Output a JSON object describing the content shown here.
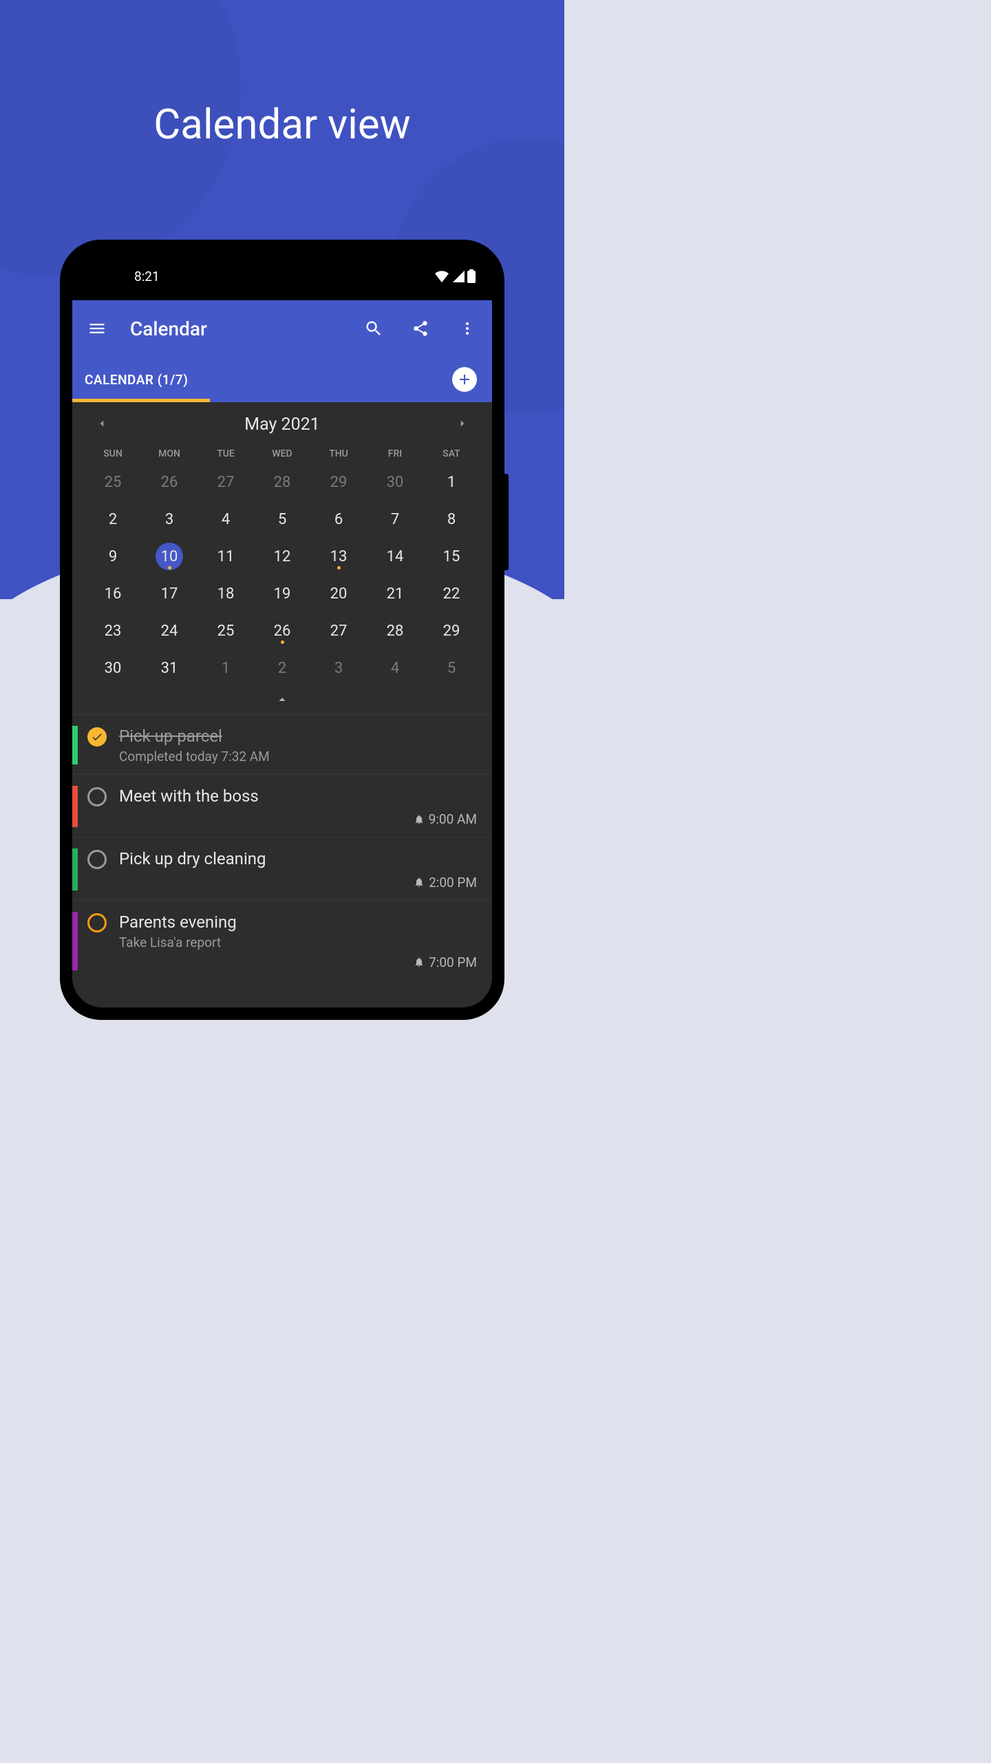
{
  "heading": "Calendar view",
  "status": {
    "time": "8:21"
  },
  "appbar": {
    "title": "Calendar"
  },
  "tab": {
    "label": "CALENDAR (1/7)"
  },
  "month": {
    "label": "May 2021"
  },
  "dow": [
    "SUN",
    "MON",
    "TUE",
    "WED",
    "THU",
    "FRI",
    "SAT"
  ],
  "weeks": [
    [
      {
        "n": "25",
        "dim": true
      },
      {
        "n": "26",
        "dim": true
      },
      {
        "n": "27",
        "dim": true
      },
      {
        "n": "28",
        "dim": true
      },
      {
        "n": "29",
        "dim": true
      },
      {
        "n": "30",
        "dim": true
      },
      {
        "n": "1"
      }
    ],
    [
      {
        "n": "2"
      },
      {
        "n": "3"
      },
      {
        "n": "4"
      },
      {
        "n": "5"
      },
      {
        "n": "6"
      },
      {
        "n": "7"
      },
      {
        "n": "8"
      }
    ],
    [
      {
        "n": "9"
      },
      {
        "n": "10",
        "selected": true,
        "dot": true
      },
      {
        "n": "11"
      },
      {
        "n": "12"
      },
      {
        "n": "13",
        "dot": true
      },
      {
        "n": "14"
      },
      {
        "n": "15"
      }
    ],
    [
      {
        "n": "16"
      },
      {
        "n": "17"
      },
      {
        "n": "18"
      },
      {
        "n": "19"
      },
      {
        "n": "20"
      },
      {
        "n": "21"
      },
      {
        "n": "22"
      }
    ],
    [
      {
        "n": "23"
      },
      {
        "n": "24"
      },
      {
        "n": "25"
      },
      {
        "n": "26",
        "dot": true
      },
      {
        "n": "27"
      },
      {
        "n": "28"
      },
      {
        "n": "29"
      }
    ],
    [
      {
        "n": "30"
      },
      {
        "n": "31"
      },
      {
        "n": "1",
        "dim": true
      },
      {
        "n": "2",
        "dim": true
      },
      {
        "n": "3",
        "dim": true
      },
      {
        "n": "4",
        "dim": true
      },
      {
        "n": "5",
        "dim": true
      }
    ]
  ],
  "tasks": [
    {
      "title": "Pick up parcel",
      "sub": "Completed today 7:32 AM",
      "done": true,
      "color": "#2ecc71",
      "time": ""
    },
    {
      "title": "Meet with the boss",
      "sub": "",
      "done": false,
      "color": "#e74c3c",
      "time": "9:00 AM",
      "ring": "gray"
    },
    {
      "title": "Pick up dry cleaning",
      "sub": "",
      "done": false,
      "color": "#27ae60",
      "time": "2:00 PM",
      "ring": "gray"
    },
    {
      "title": "Parents evening",
      "sub": "Take Lisa'a report",
      "done": false,
      "color": "#9b27b0",
      "time": "7:00 PM",
      "ring": "orange"
    }
  ]
}
